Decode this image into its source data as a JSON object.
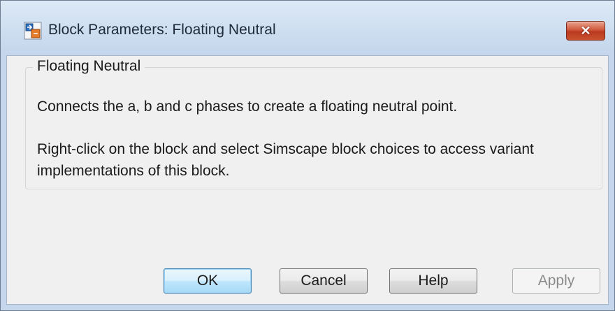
{
  "window": {
    "title": "Block Parameters: Floating Neutral",
    "icon": "simulink-block-icon",
    "close_label": "✕"
  },
  "group": {
    "legend": "Floating Neutral",
    "description_line1": "Connects the a, b and c phases to create a floating neutral point.",
    "description_line2": "Right-click on the block and select Simscape block choices to access variant implementations of this block."
  },
  "buttons": {
    "ok_label": "OK",
    "cancel_label": "Cancel",
    "help_label": "Help",
    "apply_label": "Apply"
  },
  "colors": {
    "close_button": "#c8522f",
    "default_button_border": "#3c7fb1",
    "window_frame": "#c5d7ec"
  }
}
